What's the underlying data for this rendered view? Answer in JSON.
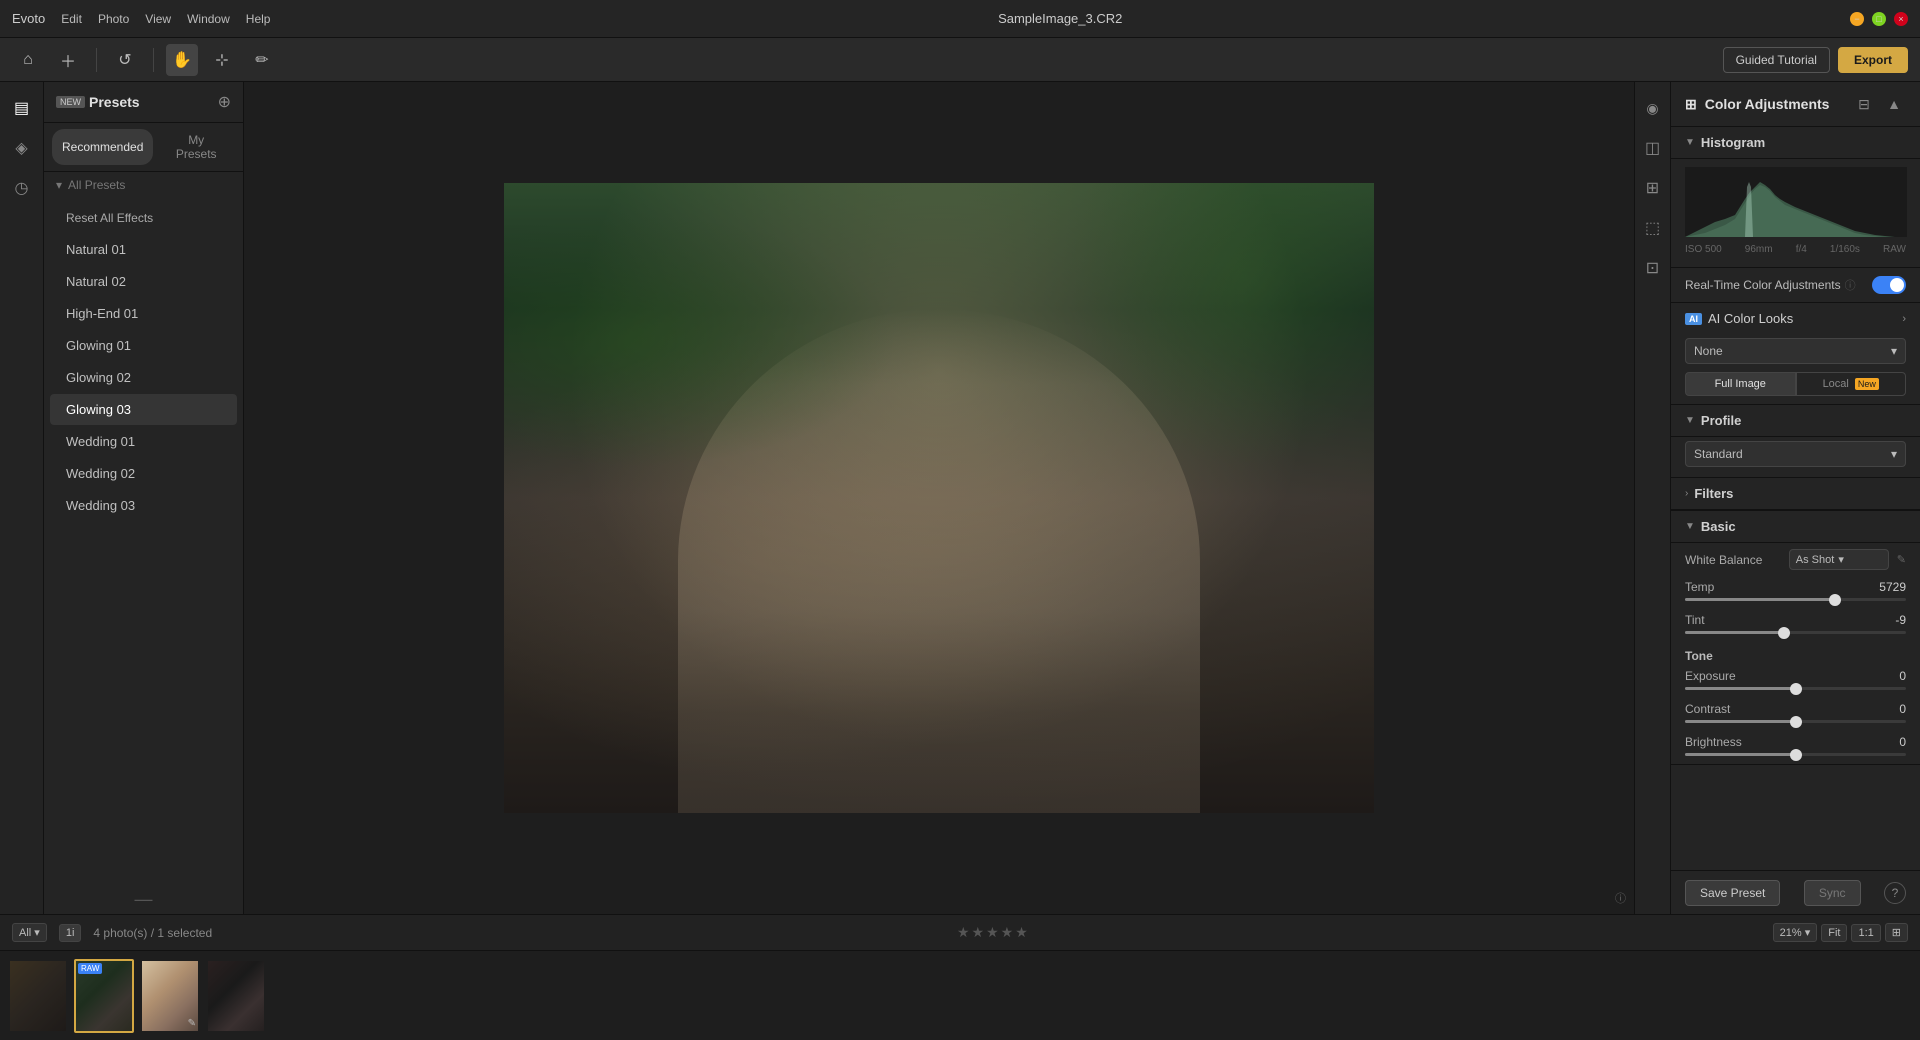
{
  "titlebar": {
    "app_name": "Evoto",
    "menu_items": [
      "Edit",
      "Photo",
      "View",
      "Window",
      "Help"
    ],
    "file_title": "SampleImage_3.CR2"
  },
  "toolbar": {
    "guided_label": "Guided Tutorial",
    "export_label": "Export"
  },
  "presets": {
    "title": "Presets",
    "tabs": [
      "Recommended",
      "My Presets"
    ],
    "active_tab": "Recommended",
    "all_presets_label": "All Presets",
    "items": [
      {
        "label": "Reset All Effects",
        "type": "reset"
      },
      {
        "label": "Natural 01"
      },
      {
        "label": "Natural 02"
      },
      {
        "label": "High-End 01"
      },
      {
        "label": "Glowing 01"
      },
      {
        "label": "Glowing 02"
      },
      {
        "label": "Glowing 03",
        "active": true
      },
      {
        "label": "Wedding 01"
      },
      {
        "label": "Wedding 02"
      },
      {
        "label": "Wedding 03"
      }
    ]
  },
  "right_panel": {
    "title": "Color Adjustments",
    "histogram": {
      "iso": "ISO 500",
      "aperture": "f/4",
      "shutter": "1/160s",
      "format": "RAW",
      "focal": "96mm"
    },
    "realtime_label": "Real-Time Color Adjustments",
    "ai_looks": {
      "title": "AI Color Looks",
      "select_value": "None",
      "tabs": [
        "Full Image",
        "Local"
      ],
      "active_tab": "Full Image"
    },
    "profile": {
      "title": "Profile",
      "value": "Standard"
    },
    "filters": {
      "title": "Filters"
    },
    "basic": {
      "title": "Basic",
      "white_balance_label": "White Balance",
      "white_balance_value": "As Shot",
      "temp_label": "Temp",
      "temp_value": "5729",
      "temp_percent": 68,
      "tint_label": "Tint",
      "tint_value": "-9",
      "tint_percent": 45,
      "tone_label": "Tone",
      "exposure_label": "Exposure",
      "exposure_value": "0",
      "exposure_percent": 50,
      "contrast_label": "Contrast",
      "contrast_value": "0",
      "contrast_percent": 50,
      "brightness_label": "Brightness",
      "brightness_value": "0",
      "brightness_percent": 50
    },
    "save_preset_label": "Save Preset",
    "sync_label": "Sync",
    "help_label": "?"
  },
  "bottom_bar": {
    "filter_label": "All",
    "view_mode": "1i",
    "photo_count": "4 photo(s) / 1 selected",
    "zoom_value": "21%",
    "fit_label": "Fit",
    "zoom_1_1": "1:1"
  },
  "filmstrip": {
    "photos": [
      {
        "id": 1,
        "has_badge": false,
        "selected": false
      },
      {
        "id": 2,
        "has_badge": true,
        "selected": true,
        "has_edit": false
      },
      {
        "id": 3,
        "has_badge": false,
        "selected": false,
        "has_edit": true
      },
      {
        "id": 4,
        "has_badge": false,
        "selected": false
      }
    ]
  }
}
